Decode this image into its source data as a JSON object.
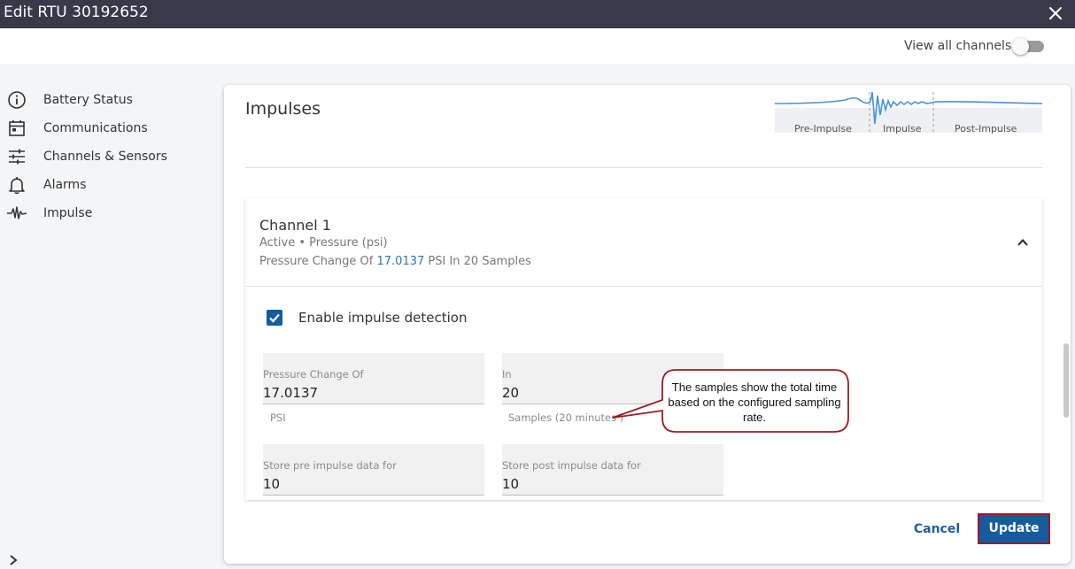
{
  "window": {
    "title": "Edit RTU 30192652",
    "close_icon": "close-icon"
  },
  "topbar": {
    "view_all_label": "View all channels",
    "view_all_on": false
  },
  "sidebar": {
    "items": [
      {
        "label": "Battery Status",
        "icon": "info-icon"
      },
      {
        "label": "Communications",
        "icon": "calendar-icon"
      },
      {
        "label": "Channels & Sensors",
        "icon": "sliders-icon"
      },
      {
        "label": "Alarms",
        "icon": "bell-icon"
      },
      {
        "label": "Impulse",
        "icon": "waveform-icon"
      }
    ]
  },
  "main": {
    "heading": "Impulses",
    "diagram": {
      "pre": "Pre-Impulse",
      "impulse": "Impulse",
      "post": "Post-Impulse"
    },
    "channel": {
      "name": "Channel 1",
      "status": "Active • Pressure (psi)",
      "summary_prefix": "Pressure Change Of ",
      "summary_value": "17.0137",
      "summary_suffix": " PSI In 20 Samples",
      "enable_label": "Enable impulse detection",
      "enable_checked": true,
      "fields": {
        "pressure": {
          "label": "Pressure Change Of",
          "value": "17.0137",
          "hint": "PSI"
        },
        "samples": {
          "label": "In",
          "value": "20",
          "hint": "Samples (20 minutes )"
        },
        "pre": {
          "label": "Store pre impulse data for",
          "value": "10"
        },
        "post": {
          "label": "Store post impulse data for",
          "value": "10"
        }
      }
    },
    "callout": "The samples show the total time based on the configured sampling rate."
  },
  "footer": {
    "cancel_label": "Cancel",
    "update_label": "Update"
  },
  "colors": {
    "accent": "#145c9e",
    "titlebar": "#383a4a",
    "link": "#2e74b5",
    "callout_border": "#9e1b21"
  }
}
